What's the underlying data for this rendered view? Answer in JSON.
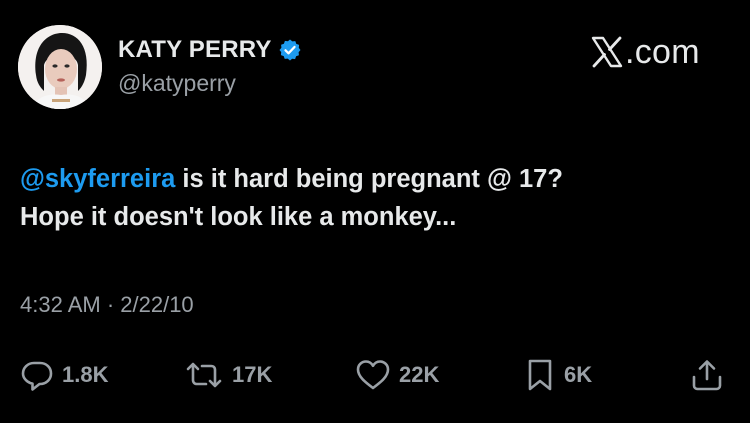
{
  "author": {
    "display_name": "KATY PERRY",
    "handle": "@katyperry",
    "verified": true
  },
  "brand": {
    "label": ".com",
    "icon": "x-logo-icon"
  },
  "tweet": {
    "mention": "@skyferreira",
    "text_line1": " is it hard being pregnant @ 17?",
    "text_line2": "Hope it doesn't look like a monkey...",
    "timestamp": "4:32 AM · 2/22/10"
  },
  "actions": {
    "reply": {
      "icon": "reply-icon",
      "count": "1.8K"
    },
    "repost": {
      "icon": "repost-icon",
      "count": "17K"
    },
    "like": {
      "icon": "heart-icon",
      "count": "22K"
    },
    "bookmark": {
      "icon": "bookmark-icon",
      "count": "6K"
    },
    "share": {
      "icon": "share-icon"
    }
  },
  "colors": {
    "background": "#000000",
    "text": "#e7e9ea",
    "secondary": "#9aa0a6",
    "accent": "#1d9bf0"
  }
}
